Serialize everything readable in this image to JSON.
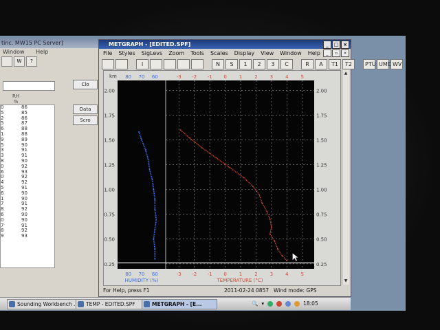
{
  "bg_window": {
    "title": "tinc. MW15 PC Server]",
    "menu": [
      "Window",
      "Help"
    ],
    "toolbar": [
      "",
      "W",
      "?"
    ],
    "rh_header": "RH",
    "rh_unit": "%",
    "rows": [
      [
        "0",
        "86"
      ],
      [
        "5",
        "85"
      ],
      [
        "2",
        "86"
      ],
      [
        "5",
        "87"
      ],
      [
        "6",
        "88"
      ],
      [
        "1",
        "88"
      ],
      [
        "9",
        "89"
      ],
      [
        "5",
        "90"
      ],
      [
        "3",
        "91"
      ],
      [
        "3",
        "91"
      ],
      [
        "8",
        "90"
      ],
      [
        "0",
        "92"
      ],
      [
        "6",
        "93"
      ],
      [
        "0",
        "92"
      ],
      [
        "4",
        "92"
      ],
      [
        "5",
        "91"
      ],
      [
        "6",
        "90"
      ],
      [
        "1",
        "90"
      ],
      [
        "7",
        "91"
      ],
      [
        "8",
        "92"
      ],
      [
        "6",
        "90"
      ],
      [
        "0",
        "90"
      ],
      [
        "7",
        "91"
      ],
      [
        "8",
        "92"
      ],
      [
        "9",
        "93"
      ]
    ],
    "buttons": {
      "close": "Clo",
      "data": "Data",
      "scroll": "Scro"
    }
  },
  "main_window": {
    "title": "METGRAPH - [EDITED.SPF]",
    "menu": [
      "File",
      "Styles",
      "SigLevs",
      "Zoom",
      "Tools",
      "Scales",
      "Display",
      "View",
      "Window",
      "Help"
    ],
    "toolbar": [
      "",
      "",
      "I",
      "",
      "",
      "",
      "",
      "N",
      "S",
      "1",
      "2",
      "3",
      "C",
      "R",
      "A",
      "T1",
      "T2",
      "PTU",
      "UMD",
      "WV"
    ],
    "status_left": "For Help, press F1",
    "status_datetime": "2011-02-24 0857",
    "status_wind": "Wind mode: GPS"
  },
  "plot": {
    "height_unit": "km",
    "height_ticks": [
      "2.00",
      "1.75",
      "1.50",
      "1.25",
      "1.00",
      "0.75",
      "0.50",
      "0.25"
    ],
    "humidity_top_ticks": [
      "80",
      "70",
      "60"
    ],
    "humidity_bottom_ticks": [
      "80",
      "70",
      "60"
    ],
    "humidity_label": "HUMIDITY (%)",
    "temperature_top_ticks": [
      "-3",
      "-2",
      "-1",
      "0",
      "1",
      "2",
      "3",
      "4",
      "5"
    ],
    "temperature_bottom_ticks": [
      "-3",
      "-2",
      "-1",
      "0",
      "1",
      "2",
      "3",
      "4",
      "5"
    ],
    "temperature_label": "TEMPERATURE (°C)",
    "colors": {
      "humidity": "#3a6cf0",
      "temperature": "#d04a3a",
      "grid": "#9a9a9a",
      "background": "#050505",
      "surface": "#e8e8e8"
    }
  },
  "chart_data": {
    "type": "line",
    "ylabel": "km",
    "ylim": [
      0.2,
      2.1
    ],
    "series": [
      {
        "name": "HUMIDITY (%)",
        "xlim": [
          85,
          55
        ],
        "points": [
          [
            60,
            0.3
          ],
          [
            60,
            0.4
          ],
          [
            61,
            0.5
          ],
          [
            60,
            0.6
          ],
          [
            59,
            0.7
          ],
          [
            60,
            0.8
          ],
          [
            60,
            0.9
          ],
          [
            61,
            1.0
          ],
          [
            62,
            1.1
          ],
          [
            64,
            1.2
          ],
          [
            65,
            1.3
          ],
          [
            67,
            1.4
          ],
          [
            70,
            1.5
          ],
          [
            72,
            1.58
          ]
        ]
      },
      {
        "name": "TEMPERATURE (°C)",
        "xlim": [
          -3.5,
          5.5
        ],
        "points": [
          [
            4.0,
            0.28
          ],
          [
            3.7,
            0.33
          ],
          [
            3.4,
            0.4
          ],
          [
            3.2,
            0.48
          ],
          [
            2.9,
            0.55
          ],
          [
            3.0,
            0.62
          ],
          [
            2.9,
            0.7
          ],
          [
            2.7,
            0.78
          ],
          [
            2.4,
            0.86
          ],
          [
            2.2,
            0.95
          ],
          [
            1.8,
            1.03
          ],
          [
            1.2,
            1.12
          ],
          [
            0.3,
            1.22
          ],
          [
            -0.6,
            1.32
          ],
          [
            -1.5,
            1.42
          ],
          [
            -2.3,
            1.52
          ],
          [
            -2.9,
            1.6
          ]
        ]
      }
    ]
  },
  "taskbar": {
    "items": [
      "Sounding Workbench ...",
      "TEMP - EDITED.SPF",
      "METGRAPH - [E..."
    ],
    "clock": "18:05"
  }
}
